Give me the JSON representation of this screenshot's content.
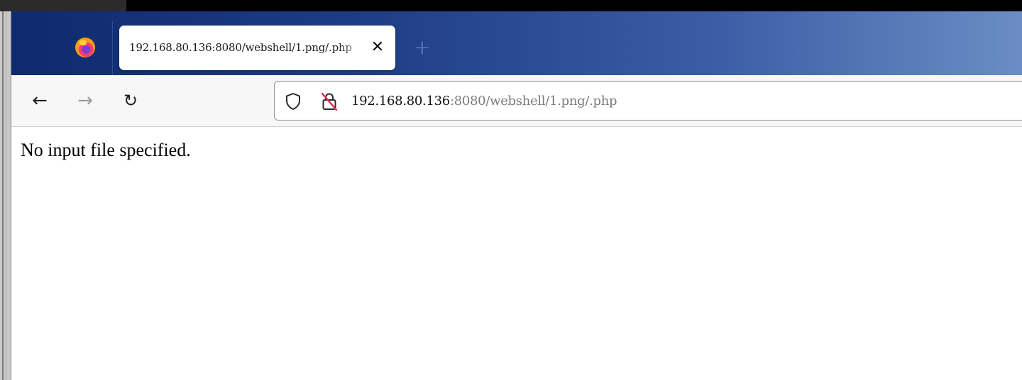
{
  "browser": {
    "tab": {
      "title": "192.168.80.136:8080/webshell/1.png/.php",
      "close_icon": "close-icon"
    },
    "new_tab_icon": "plus-icon",
    "logo_icon": "firefox-icon",
    "nav": {
      "back_icon": "arrow-left-icon",
      "forward_icon": "arrow-right-icon",
      "reload_icon": "reload-icon"
    },
    "urlbar": {
      "shield_icon": "shield-icon",
      "lock_icon": "insecure-lock-icon",
      "host": "192.168.80.136",
      "rest": ":8080/webshell/1.png/.php"
    },
    "colors": {
      "tabbar_start": "#0f2a6e",
      "tabbar_end": "#6b8dc4",
      "insecure_strike": "#e22850"
    }
  },
  "page": {
    "message": "No input file specified."
  }
}
